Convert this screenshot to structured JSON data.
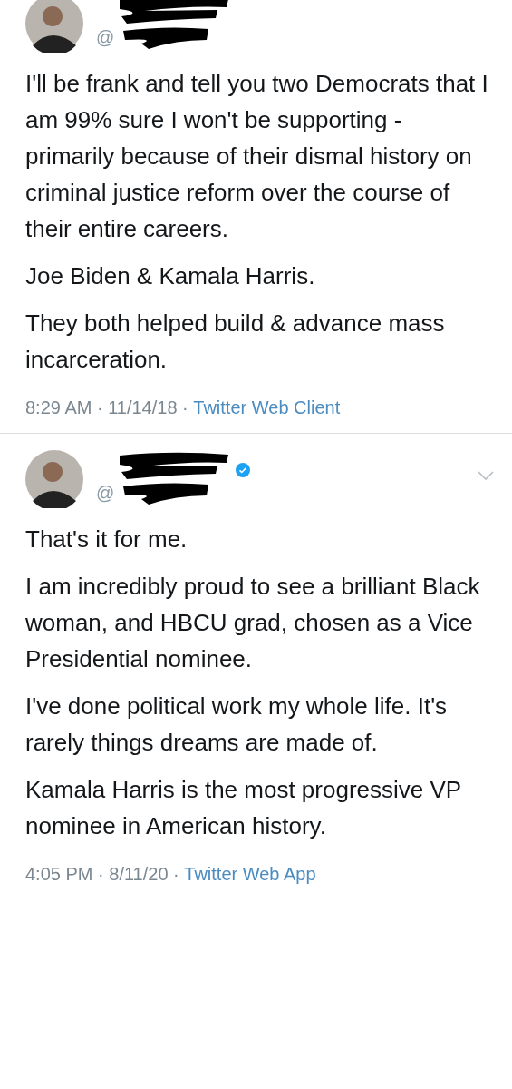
{
  "tweets": [
    {
      "handle": "@",
      "verified": false,
      "show_menu": false,
      "paragraphs": [
        "I'll be frank and tell you two Democrats that I am 99% sure I won't be supporting - primarily because of their dismal history on criminal justice reform over the course of their entire careers.",
        "Joe Biden & Kamala Harris.",
        "They both helped build & advance mass incarceration."
      ],
      "timestamp": "8:29 AM · 11/14/18 · ",
      "source": "Twitter Web Client"
    },
    {
      "handle": "@",
      "verified": true,
      "show_menu": true,
      "paragraphs": [
        "That's it for me.",
        "I am incredibly proud to see a brilliant Black woman, and HBCU grad, chosen as a Vice Presidential nominee.",
        "I've done political work my whole life. It's rarely things dreams are made of.",
        "Kamala Harris is the most progressive VP nominee in American history."
      ],
      "timestamp": "4:05 PM · 8/11/20 · ",
      "source": "Twitter Web App"
    }
  ]
}
